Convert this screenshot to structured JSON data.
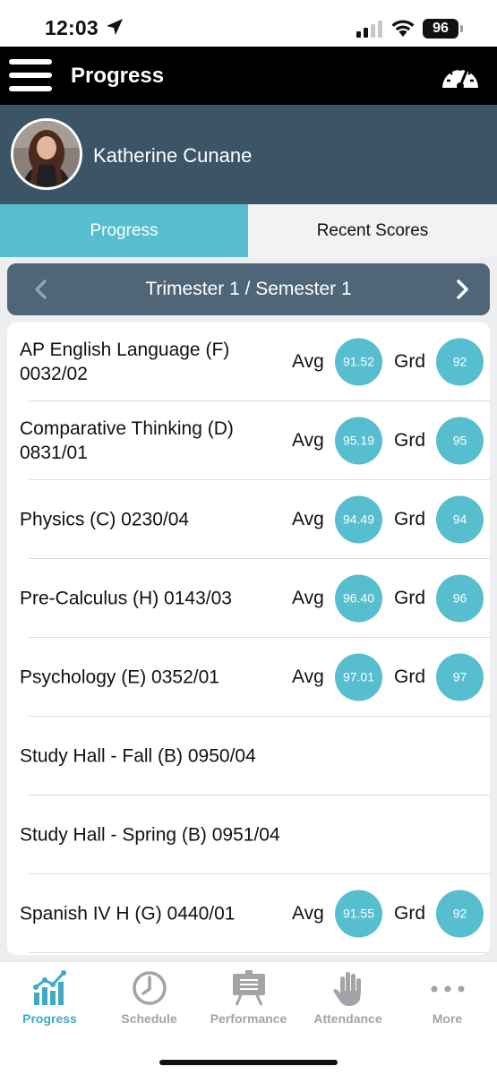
{
  "status_bar": {
    "time": "12:03",
    "battery": "96"
  },
  "header": {
    "title": "Progress",
    "menu_icon": "hamburger-menu-icon",
    "right_icon": "dashboard-gauge-icon"
  },
  "profile": {
    "name": "Katherine Cunane"
  },
  "tabs": [
    {
      "label": "Progress",
      "active": true
    },
    {
      "label": "Recent Scores",
      "active": false
    }
  ],
  "term": {
    "label": "Trimester 1 / Semester 1"
  },
  "labels": {
    "avg": "Avg",
    "grd": "Grd"
  },
  "courses": [
    {
      "name": "AP English Language (F) 0032/02",
      "avg": "91.52",
      "grd": "92"
    },
    {
      "name": "Comparative Thinking (D) 0831/01",
      "avg": "95.19",
      "grd": "95"
    },
    {
      "name": "Physics (C) 0230/04",
      "avg": "94.49",
      "grd": "94"
    },
    {
      "name": "Pre-Calculus (H) 0143/03",
      "avg": "96.40",
      "grd": "96"
    },
    {
      "name": "Psychology (E) 0352/01",
      "avg": "97.01",
      "grd": "97"
    },
    {
      "name": "Study Hall - Fall (B) 0950/04",
      "avg": null,
      "grd": null
    },
    {
      "name": "Study Hall - Spring (B) 0951/04",
      "avg": null,
      "grd": null
    },
    {
      "name": "Spanish IV H (G) 0440/01",
      "avg": "91.55",
      "grd": "92"
    }
  ],
  "nav": [
    {
      "label": "Progress",
      "icon": "bar-chart-icon",
      "active": true
    },
    {
      "label": "Schedule",
      "icon": "clock-icon",
      "active": false
    },
    {
      "label": "Performance",
      "icon": "presentation-board-icon",
      "active": false
    },
    {
      "label": "Attendance",
      "icon": "raised-hand-icon",
      "active": false
    },
    {
      "label": "More",
      "icon": "ellipsis-icon",
      "active": false
    }
  ],
  "colors": {
    "accent": "#56bece",
    "header_bg": "#000000",
    "profile_bg": "#3c5566",
    "term_bar_bg": "#4e6678",
    "nav_active": "#3fa9c6",
    "nav_inactive": "#a3a3a8"
  }
}
